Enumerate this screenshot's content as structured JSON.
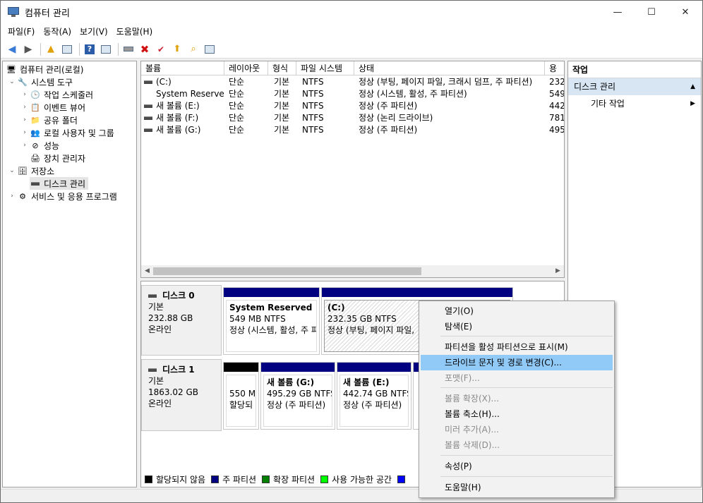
{
  "window": {
    "title": "컴퓨터 관리",
    "minimize": "—",
    "maximize": "☐",
    "close": "✕"
  },
  "menubar": {
    "items": [
      "파일(F)",
      "동작(A)",
      "보기(V)",
      "도움말(H)"
    ]
  },
  "tree": {
    "root": "컴퓨터 관리(로컬)",
    "system_tools": "시스템 도구",
    "task_scheduler": "작업 스케줄러",
    "event_viewer": "이벤트 뷰어",
    "shared_folders": "공유 폴더",
    "local_users": "로컬 사용자 및 그룹",
    "performance": "성능",
    "device_manager": "장치 관리자",
    "storage": "저장소",
    "disk_management": "디스크 관리",
    "services_apps": "서비스 및 응용 프로그램"
  },
  "volumes": {
    "columns": [
      "볼륨",
      "레이아웃",
      "형식",
      "파일 시스템",
      "상태",
      "용"
    ],
    "rows": [
      {
        "name": "(C:)",
        "layout": "단순",
        "type": "기본",
        "fs": "NTFS",
        "status": "정상 (부팅, 페이지 파일, 크래시 덤프, 주 파티션)",
        "cap": "232"
      },
      {
        "name": "System Reserved",
        "layout": "단순",
        "type": "기본",
        "fs": "NTFS",
        "status": "정상 (시스템, 활성, 주 파티션)",
        "cap": "549"
      },
      {
        "name": "새 볼륨 (E:)",
        "layout": "단순",
        "type": "기본",
        "fs": "NTFS",
        "status": "정상 (주 파티션)",
        "cap": "442"
      },
      {
        "name": "새 볼륨 (F:)",
        "layout": "단순",
        "type": "기본",
        "fs": "NTFS",
        "status": "정상 (논리 드라이브)",
        "cap": "781"
      },
      {
        "name": "새 볼륨 (G:)",
        "layout": "단순",
        "type": "기본",
        "fs": "NTFS",
        "status": "정상 (주 파티션)",
        "cap": "495"
      }
    ]
  },
  "disks": {
    "disk0": {
      "name": "디스크 0",
      "type": "기본",
      "size": "232.88 GB",
      "state": "온라인",
      "p1": {
        "title": "System Reserved",
        "size": "549 MB NTFS",
        "status": "정상 (시스템, 활성, 주 파"
      },
      "p2": {
        "title": "(C:)",
        "size": "232.35 GB NTFS",
        "status": "정상 (부팅, 페이지 파일,"
      }
    },
    "disk1": {
      "name": "디스크 1",
      "type": "기본",
      "size": "1863.02 GB",
      "state": "온라인",
      "p1": {
        "size": "550 M",
        "status": "할당되"
      },
      "p2": {
        "title": "새 볼륨  (G:)",
        "size": "495.29 GB NTFS",
        "status": "정상 (주 파티션)"
      },
      "p3": {
        "title": "새 볼륨  (E:)",
        "size": "442.74 GB NTFS",
        "status": "정상 (주 파티션)"
      }
    }
  },
  "legend": [
    {
      "label": "할당되지 않음",
      "color": "#000000"
    },
    {
      "label": "주 파티션",
      "color": "#000080"
    },
    {
      "label": "확장 파티션",
      "color": "#008000"
    },
    {
      "label": "사용 가능한 공간",
      "color": "#00ff00"
    },
    {
      "label": "",
      "color": "#0000ff"
    }
  ],
  "actions": {
    "header": "작업",
    "section": "디스크 관리",
    "more": "기타 작업"
  },
  "context_menu": {
    "open": "열기(O)",
    "explore": "탐색(E)",
    "mark_active": "파티션을 활성 파티션으로 표시(M)",
    "change_letter": "드라이브 문자 및 경로 변경(C)...",
    "format": "포맷(F)...",
    "extend": "볼륨 확장(X)...",
    "shrink": "볼륨 축소(H)...",
    "add_mirror": "미러 추가(A)...",
    "delete": "볼륨 삭제(D)...",
    "properties": "속성(P)",
    "help": "도움말(H)"
  },
  "colors": {
    "primary_partition": "#000080",
    "unallocated": "#000000",
    "highlight": "#91c9f7",
    "action_section": "#d8e6f3"
  }
}
